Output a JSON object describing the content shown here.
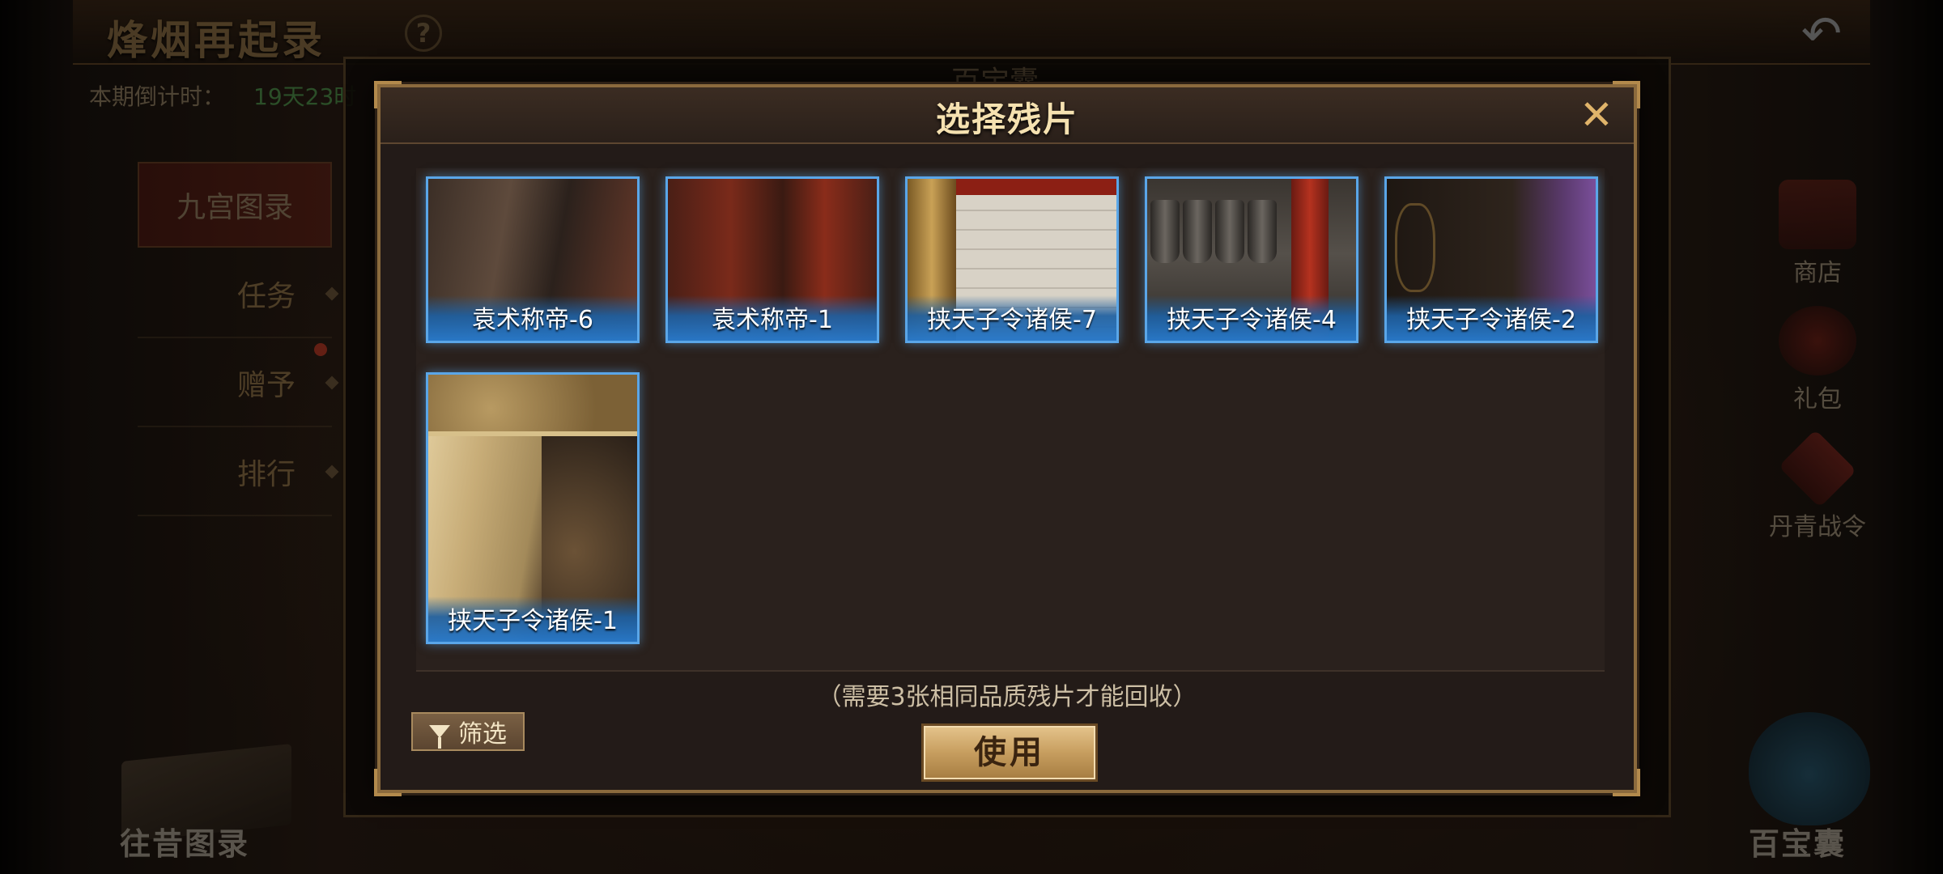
{
  "header": {
    "event_title": "烽烟再起录",
    "help_symbol": "?",
    "countdown_label": "本期倒计时：",
    "countdown_value": "19天23时",
    "back_icon": "back-arrow-icon"
  },
  "nav": {
    "active": "九宫图录",
    "items": [
      "任务",
      "赠予",
      "排行"
    ]
  },
  "sidebar_right": [
    {
      "label": "商店",
      "icon": "chest-icon"
    },
    {
      "label": "礼包",
      "icon": "gift-bag-icon"
    },
    {
      "label": "丹青战令",
      "icon": "battle-order-icon"
    }
  ],
  "bottom": {
    "left_label": "往昔图录",
    "right_label": "百宝囊"
  },
  "back_panel": {
    "title": "百宝囊"
  },
  "dialog": {
    "title": "选择残片",
    "close_symbol": "✕",
    "cards": [
      {
        "name": "袁术称帝-6"
      },
      {
        "name": "袁术称帝-1"
      },
      {
        "name": "挟天子令诸侯-7"
      },
      {
        "name": "挟天子令诸侯-4"
      },
      {
        "name": "挟天子令诸侯-2"
      },
      {
        "name": "挟天子令诸侯-1"
      }
    ],
    "hint": "（需要3张相同品质残片才能回收）",
    "filter_label": "筛选",
    "use_label": "使用"
  },
  "colors": {
    "accent_gold": "#e0b46a",
    "card_border": "#5aa6e8",
    "button_gold": "#c79e5f"
  }
}
